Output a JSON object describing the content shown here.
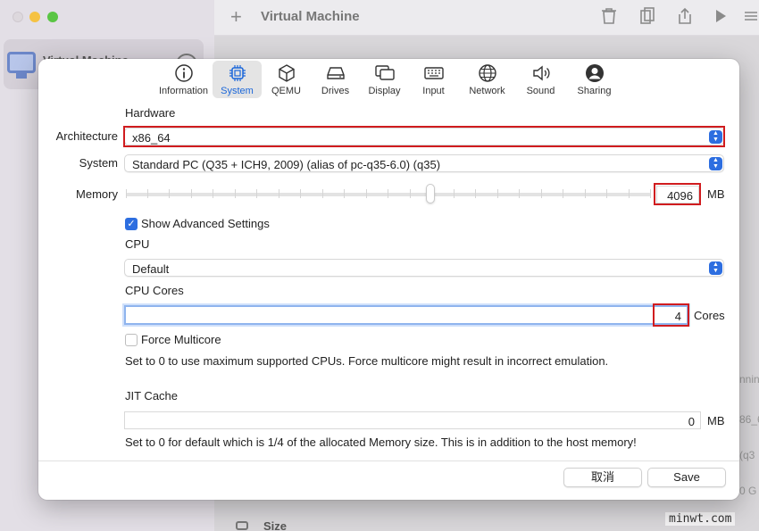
{
  "background": {
    "window_title": "Virtual Machine",
    "vm_name": "Virtual Machine",
    "side_fragments": [
      "nnin",
      "86_6",
      "(q3",
      "0 G"
    ],
    "size_label": "Size",
    "watermark": "minwt.com"
  },
  "tabs": [
    {
      "label": "Information",
      "icon": "info-icon"
    },
    {
      "label": "System",
      "icon": "cpu-icon",
      "active": true
    },
    {
      "label": "QEMU",
      "icon": "cube-icon"
    },
    {
      "label": "Drives",
      "icon": "drive-icon"
    },
    {
      "label": "Display",
      "icon": "display-icon"
    },
    {
      "label": "Input",
      "icon": "keyboard-icon"
    },
    {
      "label": "Network",
      "icon": "globe-icon"
    },
    {
      "label": "Sound",
      "icon": "speaker-icon"
    },
    {
      "label": "Sharing",
      "icon": "person-icon"
    }
  ],
  "hardware": {
    "heading": "Hardware",
    "architecture_label": "Architecture",
    "architecture_value": "x86_64",
    "system_label": "System",
    "system_value": "Standard PC (Q35 + ICH9, 2009) (alias of pc-q35-6.0) (q35)",
    "memory_label": "Memory",
    "memory_value": "4096",
    "memory_unit": "MB",
    "memory_slider_fraction": 0.58
  },
  "advanced": {
    "show_advanced_label": "Show Advanced Settings",
    "show_advanced_checked": true,
    "cpu_heading": "CPU",
    "cpu_value": "Default",
    "cpu_cores_heading": "CPU Cores",
    "cpu_cores_value": "4",
    "cpu_cores_unit": "Cores",
    "force_multicore_label": "Force Multicore",
    "force_multicore_checked": false,
    "cores_note": "Set to 0 to use maximum supported CPUs. Force multicore might result in incorrect emulation.",
    "jit_heading": "JIT Cache",
    "jit_value": "0",
    "jit_unit": "MB",
    "jit_note": "Set to 0 for default which is 1/4 of the allocated Memory size. This is in addition to the host memory!"
  },
  "buttons": {
    "cancel": "取消",
    "save": "Save"
  },
  "colors": {
    "accent": "#2d6ee0",
    "highlight": "#d01c1f"
  }
}
